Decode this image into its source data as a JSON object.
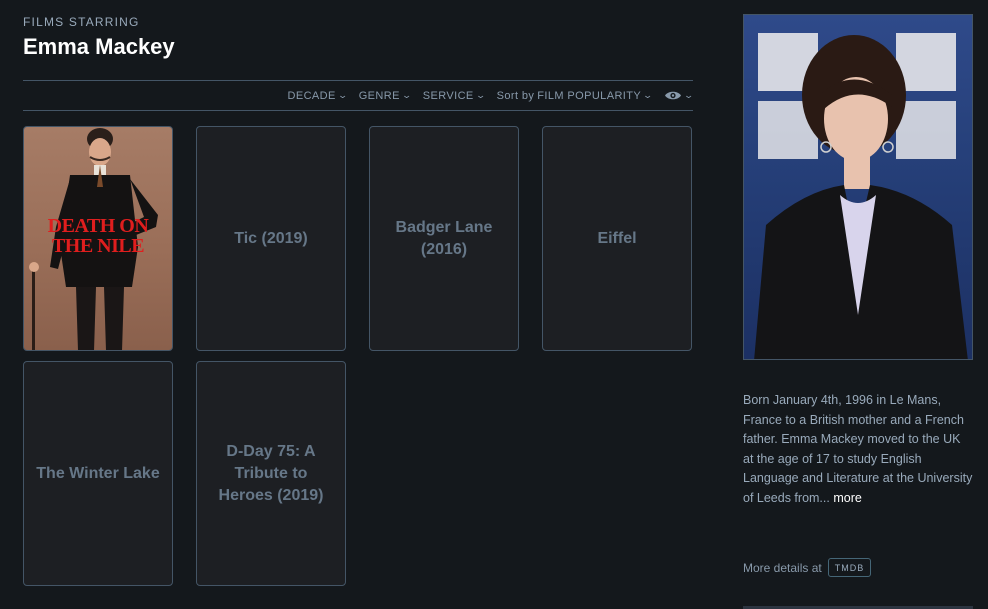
{
  "header": {
    "kicker": "FILMS STARRING",
    "name": "Emma Mackey"
  },
  "filters": {
    "decade": "DECADE",
    "genre": "GENRE",
    "service": "SERVICE",
    "sort_prefix": "Sort by",
    "sort_value": "FILM POPULARITY",
    "visibility_icon": "eye-icon",
    "chevron_icon": "chevron-down-icon"
  },
  "films": [
    {
      "title": "Death on the Nile",
      "has_poster": true,
      "poster_text": "DEATH ON THE NILE"
    },
    {
      "title": "Tic (2019)",
      "has_poster": false
    },
    {
      "title": "Badger Lane (2016)",
      "has_poster": false
    },
    {
      "title": "Eiffel",
      "has_poster": false
    },
    {
      "title": "The Winter Lake",
      "has_poster": false
    },
    {
      "title": "D-Day 75: A Tribute to Heroes (2019)",
      "has_poster": false
    }
  ],
  "sidebar": {
    "bio": "Born January 4th, 1996 in Le Mans, France to a British mother and a French father. Emma Mackey moved to the UK at the age of 17 to study English Language and Literature at the University of Leeds from...",
    "more_label": "more",
    "details_label": "More details at",
    "tmdb_label": "TMDB"
  },
  "colors": {
    "background": "#14181c",
    "text": "#99aabb",
    "accent_red": "#e01e1e"
  }
}
